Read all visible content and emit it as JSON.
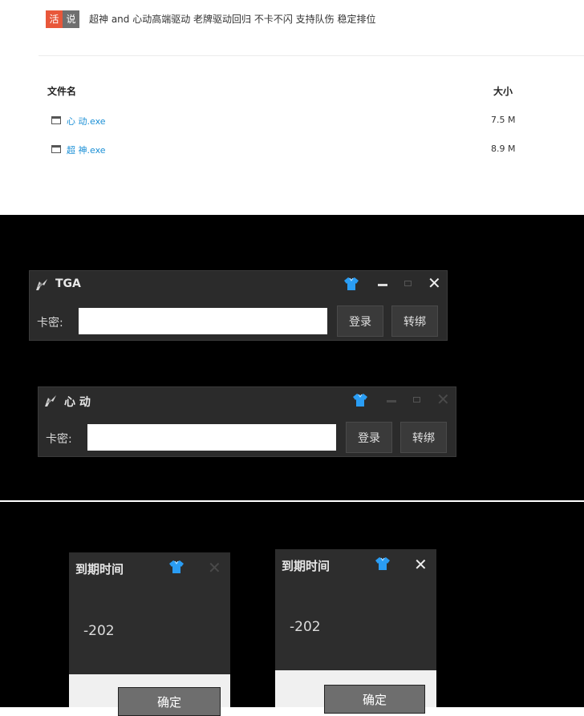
{
  "post": {
    "tag1": "活",
    "tag2": "说",
    "text": "超神 and 心动高端驱动 老牌驱动回归 不卡不闪 支持队伤 稳定排位"
  },
  "table": {
    "col_name": "文件名",
    "col_size": "大小",
    "rows": [
      {
        "name": "心 动.exe",
        "size": "7.5 M"
      },
      {
        "name": "超 神.exe",
        "size": "8.9 M"
      }
    ]
  },
  "login1": {
    "title": "TGA",
    "label": "卡密:",
    "input_value": "",
    "login_button": "登录",
    "rebind_button": "转绑"
  },
  "login2": {
    "title": "心 动",
    "label": "卡密:",
    "input_value": "",
    "login_button": "登录",
    "rebind_button": "转绑"
  },
  "expiry1": {
    "title": "到期时间",
    "value": "-202",
    "ok_button": "确定"
  },
  "expiry2": {
    "title": "到期时间",
    "value": "-202",
    "ok_button": "确定"
  },
  "icons": {
    "app_icon": "smoke-logo-icon",
    "skin_icon": "shirt-icon",
    "file_icon": "window-file-icon"
  },
  "colors": {
    "accent_link": "#1a8fd6",
    "tag_orange": "#e8573a",
    "shirt_blue": "#2a9df4",
    "window_bg": "#2b2b2b"
  }
}
